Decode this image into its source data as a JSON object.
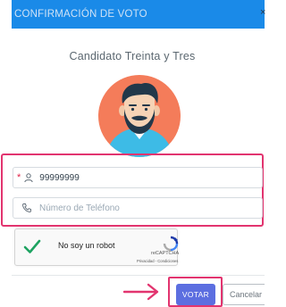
{
  "dialog": {
    "title": "CONFIRMACIÓN DE VOTO",
    "close_label": "×",
    "header_color": "#1a8ae8"
  },
  "candidate": {
    "name": "Candidato Treinta y Tres",
    "avatar_icon": "man-beard-avatar"
  },
  "form": {
    "required_mark": "*",
    "id_field": {
      "value": "99999999",
      "icon": "user-icon"
    },
    "phone_field": {
      "placeholder": "Número de Teléfono",
      "icon": "phone-icon"
    }
  },
  "captcha": {
    "label": "No soy un robot",
    "brand": "reCAPTCHA",
    "terms": "Privacidad - Condiciones",
    "checked": true
  },
  "actions": {
    "vote_label": "VOTAR",
    "cancel_label": "Cancelar",
    "vote_color": "#5c6ee0",
    "highlight_color": "#e2346f"
  }
}
